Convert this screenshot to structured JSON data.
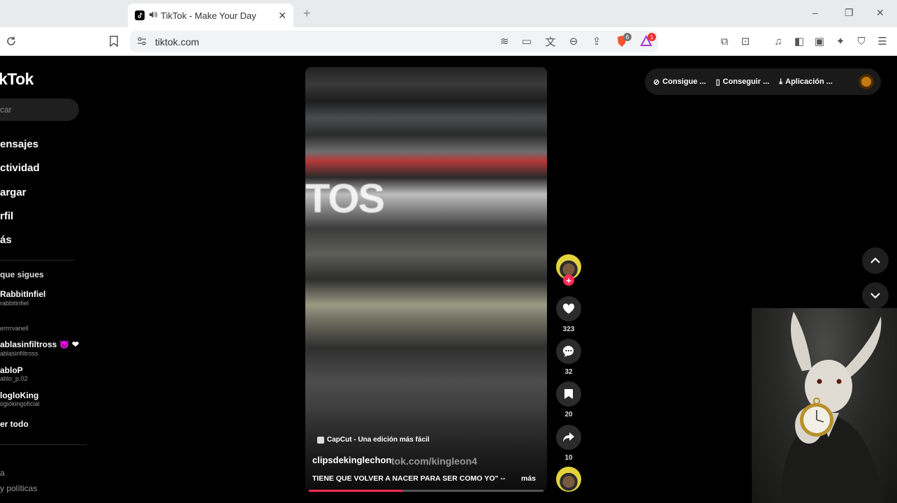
{
  "browser": {
    "tab_title": "TikTok - Make Your Day",
    "new_tab": "+",
    "url": "tiktok.com",
    "shield_count": "6",
    "rewards_count": "1",
    "window_controls": [
      "–",
      "❐",
      "✕"
    ]
  },
  "sidebar": {
    "logo": "kTok",
    "search_placeholder": "car",
    "nav": [
      "ensajes",
      "ctividad",
      "argar",
      "rfil",
      "ás"
    ],
    "following_heading": "que sigues",
    "following": [
      {
        "name": "RabbitInfiel",
        "handle": "rabbitinfiel"
      },
      {
        "name": "",
        "handle": "errrrvanell"
      },
      {
        "name": "ablasinfiltross 😈 ❤",
        "handle": "ablasinfiltross"
      },
      {
        "name": "abloP",
        "handle": "ablo_p.02"
      },
      {
        "name": "logloKing",
        "handle": "ogiokingoficial"
      }
    ],
    "see_all": "er todo",
    "footer": [
      "a",
      "y políticas"
    ]
  },
  "video": {
    "overlay_text": "TOS",
    "capcut": "CapCut - Una edición más fácil",
    "author": "clipsdekinglechon",
    "watermark": "tok.com/kingleon4",
    "caption": "TIENE QUE VOLVER A NACER PARA SER COMO YO\" --",
    "more": "más",
    "progress": 0.4
  },
  "actions": {
    "likes": "323",
    "comments": "32",
    "saves": "20",
    "shares": "10"
  },
  "top_pill": {
    "coins": "Consigue ...",
    "app": "Conseguir ...",
    "download": "Aplicación ..."
  },
  "colors": {
    "accent": "#fe2c55",
    "background": "#000000"
  }
}
